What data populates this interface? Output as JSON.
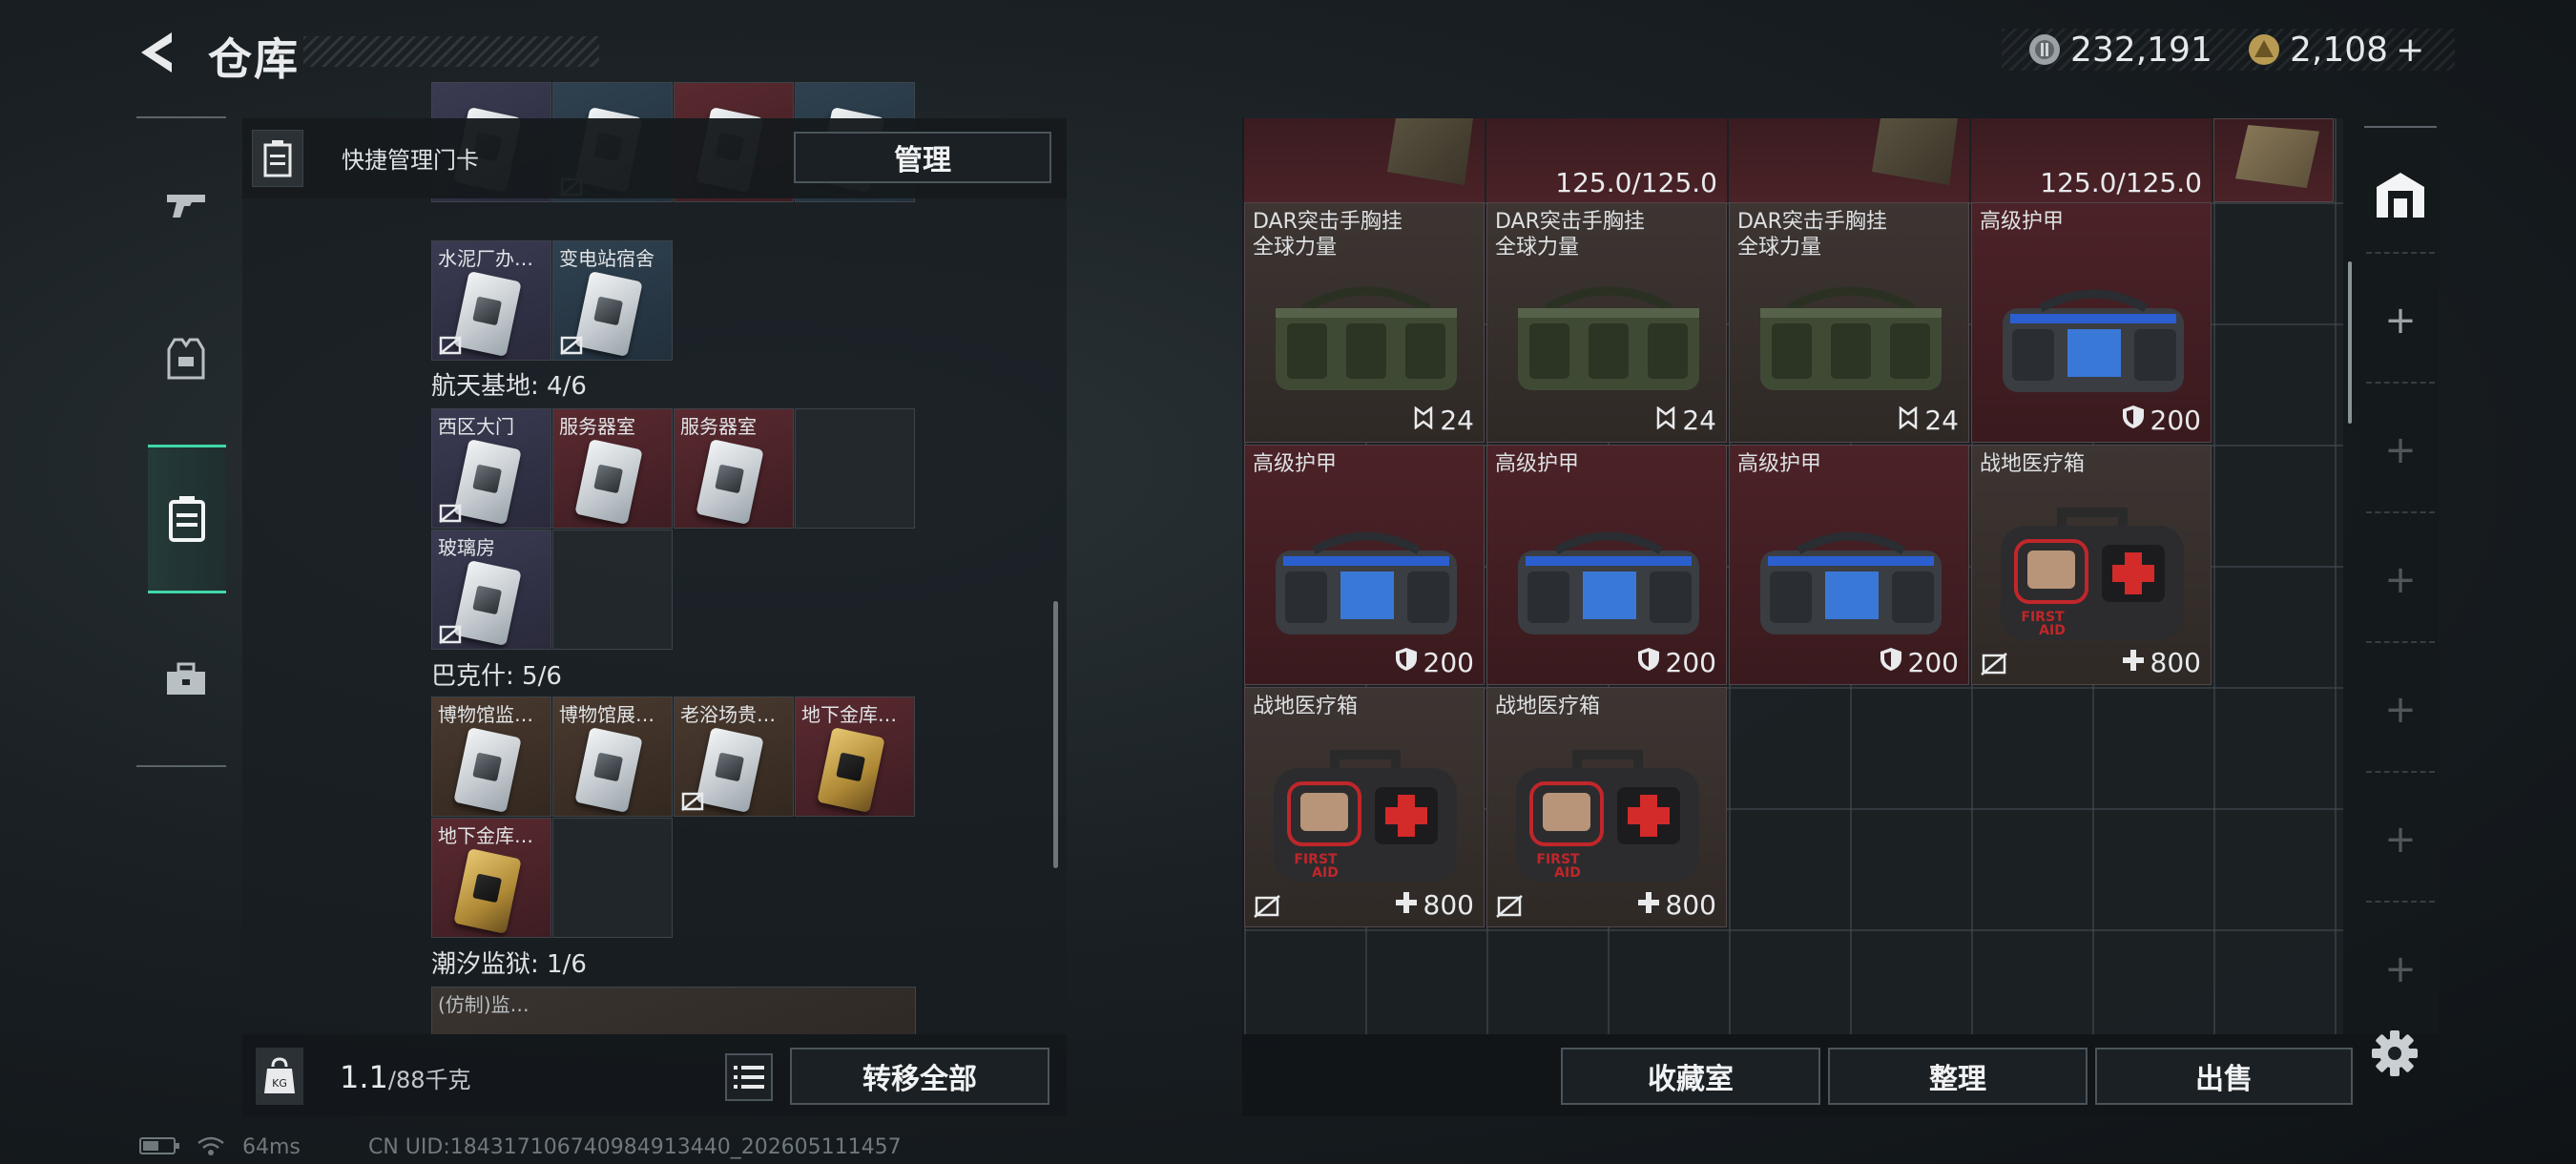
{
  "header": {
    "title": "仓库",
    "currency_silver": "232,191",
    "currency_gold": "2,108",
    "plus": "+"
  },
  "left_nav": {
    "items": [
      {
        "icon": "gun-icon"
      },
      {
        "icon": "armor-vest-icon"
      },
      {
        "icon": "keycard-case-icon",
        "active": true
      },
      {
        "icon": "toolbox-icon"
      }
    ]
  },
  "left_panel": {
    "header_label": "快捷管理门卡",
    "manage_label": "管理",
    "sections": [
      {
        "title": "",
        "cards": [
          {
            "label": "",
            "color": "purple",
            "nolink": false
          },
          {
            "label": "",
            "color": "blue",
            "nolink": true
          },
          {
            "label": "",
            "color": "red",
            "nolink": false
          },
          {
            "label": "",
            "color": "blue",
            "nolink": false
          },
          {
            "label": "水泥厂办…",
            "color": "purple",
            "nolink": true
          },
          {
            "label": "变电站宿舍",
            "color": "blue",
            "nolink": true
          }
        ]
      },
      {
        "title": "航天基地: 4/6",
        "cards": [
          {
            "label": "西区大门",
            "color": "purple",
            "nolink": true
          },
          {
            "label": "服务器室",
            "color": "red",
            "nolink": false
          },
          {
            "label": "服务器室",
            "color": "red",
            "nolink": false
          },
          {
            "label": "",
            "color": "empty",
            "nolink": false
          },
          {
            "label": "玻璃房",
            "color": "purple",
            "nolink": true
          },
          {
            "label": "",
            "color": "empty",
            "nolink": false
          }
        ]
      },
      {
        "title": "巴克什: 5/6",
        "cards": [
          {
            "label": "博物馆监…",
            "color": "brown",
            "nolink": false
          },
          {
            "label": "博物馆展…",
            "color": "brown",
            "nolink": false
          },
          {
            "label": "老浴场贵…",
            "color": "brown",
            "nolink": true
          },
          {
            "label": "地下金库…",
            "color": "gold",
            "nolink": false
          },
          {
            "label": "地下金库…",
            "color": "gold",
            "nolink": false
          },
          {
            "label": "",
            "color": "empty",
            "nolink": false
          }
        ]
      },
      {
        "title": "潮汐监狱: 1/6",
        "cards": [
          {
            "label": "(仿制)监…",
            "color": "brown",
            "nolink": false
          }
        ]
      }
    ],
    "weight_current": "1.1",
    "weight_max": "/88千克",
    "transfer_all_label": "转移全部"
  },
  "right_panel": {
    "top_row": [
      {
        "durability": "125.0/125.0"
      },
      {
        "durability": "125.0/125.0"
      }
    ],
    "items": [
      {
        "name_line1": "DAR突击手胸挂",
        "name_line2": "全球力量",
        "type": "bag-green",
        "bg": "brown",
        "value": "24",
        "value_icon": "capacity-icon",
        "nolink": false
      },
      {
        "name_line1": "DAR突击手胸挂",
        "name_line2": "全球力量",
        "type": "bag-green",
        "bg": "brown",
        "value": "24",
        "value_icon": "capacity-icon",
        "nolink": false
      },
      {
        "name_line1": "DAR突击手胸挂",
        "name_line2": "全球力量",
        "type": "bag-green",
        "bg": "brown",
        "value": "24",
        "value_icon": "capacity-icon",
        "nolink": false
      },
      {
        "name_line1": "高级护甲",
        "name_line2": "",
        "type": "bag-blue",
        "bg": "red",
        "value": "200",
        "value_icon": "shield-icon",
        "nolink": false
      },
      {
        "name_line1": "高级护甲",
        "name_line2": "",
        "type": "bag-blue",
        "bg": "red",
        "value": "200",
        "value_icon": "shield-icon",
        "nolink": false
      },
      {
        "name_line1": "高级护甲",
        "name_line2": "",
        "type": "bag-blue",
        "bg": "red",
        "value": "200",
        "value_icon": "shield-icon",
        "nolink": false
      },
      {
        "name_line1": "高级护甲",
        "name_line2": "",
        "type": "bag-blue",
        "bg": "red",
        "value": "200",
        "value_icon": "shield-icon",
        "nolink": false
      },
      {
        "name_line1": "战地医疗箱",
        "name_line2": "",
        "type": "medkit",
        "bg": "brown",
        "value": "800",
        "value_icon": "heal-plus-icon",
        "nolink": true
      },
      {
        "name_line1": "战地医疗箱",
        "name_line2": "",
        "type": "medkit",
        "bg": "brown",
        "value": "800",
        "value_icon": "heal-plus-icon",
        "nolink": true
      },
      {
        "name_line1": "战地医疗箱",
        "name_line2": "",
        "type": "medkit",
        "bg": "brown",
        "value": "800",
        "value_icon": "heal-plus-icon",
        "nolink": true
      }
    ],
    "vault_label": "收藏室",
    "sort_label": "整理",
    "sell_label": "出售"
  },
  "status_bar": {
    "ping": "64ms",
    "uid": "CN UID:1843171067409849134​40_202605111457"
  }
}
